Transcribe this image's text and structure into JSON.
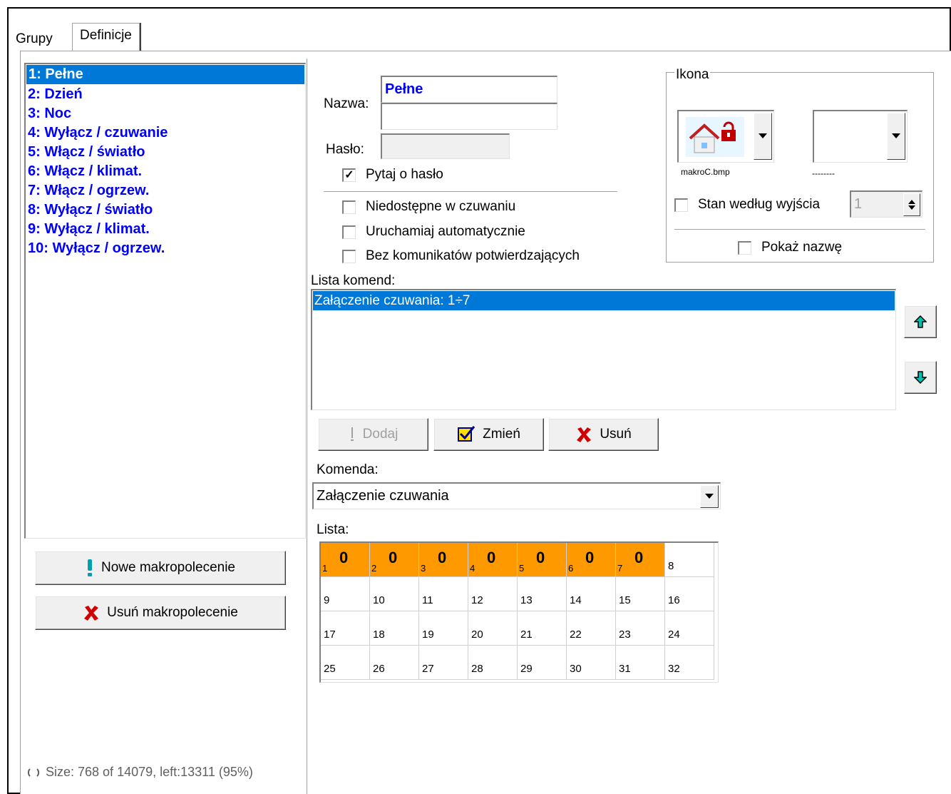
{
  "tabs": [
    {
      "label": "Grupy",
      "active": false
    },
    {
      "label": "Definicje",
      "active": true
    }
  ],
  "macros": [
    {
      "label": "1: Pełne",
      "selected": true
    },
    {
      "label": "2: Dzień"
    },
    {
      "label": "3: Noc"
    },
    {
      "label": "4: Wyłącz / czuwanie"
    },
    {
      "label": "5: Włącz / światło"
    },
    {
      "label": "6: Włącz / klimat."
    },
    {
      "label": "7: Włącz / ogrzew."
    },
    {
      "label": "8: Wyłącz / światło"
    },
    {
      "label": "9: Wyłącz / klimat."
    },
    {
      "label": "10: Wyłącz / ogrzew."
    }
  ],
  "left_buttons": {
    "new_macro": "Nowe makropolecenie",
    "delete_macro": "Usuń makropolecenie"
  },
  "status": "Size: 768 of 14079, left:13311 (95%)",
  "form": {
    "name_label": "Nazwa:",
    "name_value": "Pełne",
    "name_value2": "",
    "password_label": "Hasło:",
    "password_value": "",
    "ask_password": {
      "label": "Pytaj o hasło",
      "checked": true
    },
    "unavailable_armed": {
      "label": "Niedostępne w czuwaniu",
      "checked": false
    },
    "auto_run": {
      "label": "Uruchamiaj automatycznie",
      "checked": false
    },
    "no_confirm": {
      "label": "Bez komunikatów potwierdzających",
      "checked": false
    }
  },
  "icon_group": {
    "title": "Ikona",
    "icon1_file": "makroC.bmp",
    "icon2_file": "--------",
    "state_by_output": {
      "label": "Stan według wyjścia",
      "checked": false
    },
    "output_value": "1",
    "show_name": {
      "label": "Pokaż nazwę",
      "checked": false
    }
  },
  "commands": {
    "label": "Lista komend:",
    "items": [
      "Załączenie czuwania: 1÷7"
    ],
    "add": "Dodaj",
    "change": "Zmień",
    "delete": "Usuń",
    "command_label": "Komenda:",
    "command_value": "Załączenie czuwania",
    "list_label": "Lista:"
  },
  "grid": {
    "cells": [
      {
        "n": "1",
        "on": true,
        "v": "0"
      },
      {
        "n": "2",
        "on": true,
        "v": "0"
      },
      {
        "n": "3",
        "on": true,
        "v": "0"
      },
      {
        "n": "4",
        "on": true,
        "v": "0"
      },
      {
        "n": "5",
        "on": true,
        "v": "0"
      },
      {
        "n": "6",
        "on": true,
        "v": "0"
      },
      {
        "n": "7",
        "on": true,
        "v": "0"
      },
      {
        "n": "8",
        "on": false,
        "v": ""
      },
      {
        "n": "9"
      },
      {
        "n": "10"
      },
      {
        "n": "11"
      },
      {
        "n": "12"
      },
      {
        "n": "13"
      },
      {
        "n": "14"
      },
      {
        "n": "15"
      },
      {
        "n": "16"
      },
      {
        "n": "17"
      },
      {
        "n": "18"
      },
      {
        "n": "19"
      },
      {
        "n": "20"
      },
      {
        "n": "21"
      },
      {
        "n": "22"
      },
      {
        "n": "23"
      },
      {
        "n": "24"
      },
      {
        "n": "25"
      },
      {
        "n": "26"
      },
      {
        "n": "27"
      },
      {
        "n": "28"
      },
      {
        "n": "29"
      },
      {
        "n": "30"
      },
      {
        "n": "31"
      },
      {
        "n": "32"
      }
    ]
  },
  "colors": {
    "selection": "#0078d7",
    "macro_text": "#0000ff",
    "active_cell": "#ff9900",
    "arrow_teal": "#00a0a0"
  }
}
